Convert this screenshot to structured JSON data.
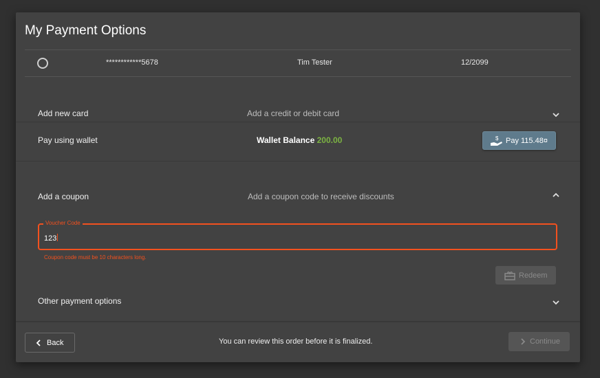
{
  "dialog": {
    "title": "My Payment Options"
  },
  "saved_card": {
    "number": "************5678",
    "holder": "Tim Tester",
    "expiry": "12/2099",
    "selected": false
  },
  "new_card": {
    "label": "Add new card",
    "description": "Add a credit or debit card",
    "icon": "chevron-down-icon"
  },
  "wallet": {
    "label": "Pay using wallet",
    "balance_label": "Wallet Balance",
    "balance_value": "200.00",
    "balance_color": "#7cb342",
    "pay_button": "Pay 115.48¤",
    "pay_icon": "hand-dollar-icon"
  },
  "coupon": {
    "label": "Add a coupon",
    "description": "Add a coupon code to receive discounts",
    "icon": "chevron-up-icon",
    "field_label": "Voucher Code",
    "field_value": "123",
    "error": "Coupon code must be 10 characters long.",
    "error_color": "#f4511e",
    "redeem_button": "Redeem",
    "redeem_icon": "gift-card-icon"
  },
  "other": {
    "label": "Other payment options",
    "icon": "chevron-down-icon"
  },
  "footer": {
    "back_button": "Back",
    "note": "You can review this order before it is finalized.",
    "continue_button": "Continue"
  }
}
